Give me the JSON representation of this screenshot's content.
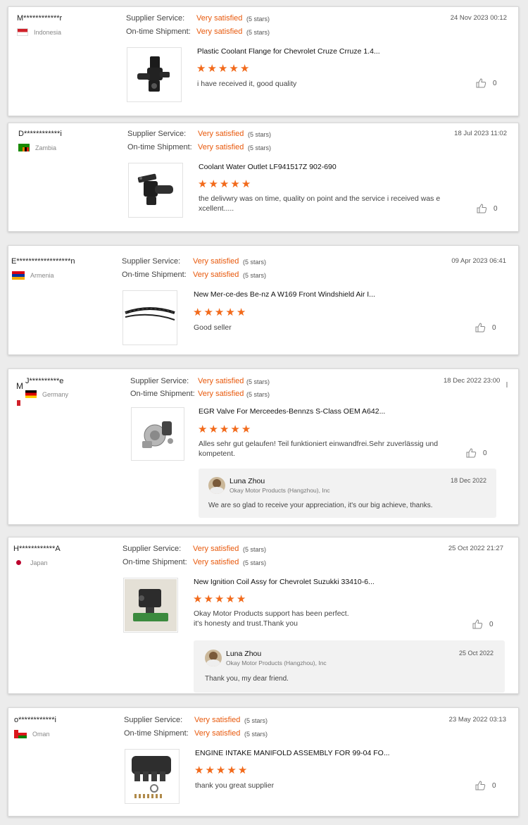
{
  "reviews": [
    {
      "user": "M************r",
      "country": "Indonesia",
      "service_label": "Supplier Service:",
      "service_value": "Very satisfied",
      "service_stars": "(5 stars)",
      "shipment_label": "On-time Shipment:",
      "shipment_value": "Very satisfied",
      "shipment_stars": "(5 stars)",
      "date": "24 Nov 2023 00:12",
      "product": "Plastic Coolant Flange for Chevrolet Cruze Crruze 1.4...",
      "rating": 5,
      "comment": "i have received it, good quality",
      "likes": "0"
    },
    {
      "user": "D************i",
      "country": "Zambia",
      "service_label": "Supplier Service:",
      "service_value": "Very satisfied",
      "service_stars": "(5 stars)",
      "shipment_label": "On-time Shipment:",
      "shipment_value": "Very satisfied",
      "shipment_stars": "(5 stars)",
      "date": "18 Jul 2023 11:02",
      "product": "Coolant Water Outlet LF941517Z 902-690",
      "rating": 5,
      "comment_line1": "the delivwry was on time, quality on point and the service i received was e",
      "comment_line2": "xcellent.....",
      "likes": "0"
    },
    {
      "user": "E******************n",
      "country": "Armenia",
      "service_label": "Supplier Service:",
      "service_value": "Very satisfied",
      "service_stars": "(5 stars)",
      "shipment_label": "On-time Shipment:",
      "shipment_value": "Very satisfied",
      "shipment_stars": "(5 stars)",
      "date": "09 Apr 2023 06:41",
      "product": "New Mer-ce-des Be-nz A W169 Front Windshield Air I...",
      "rating": 5,
      "comment": "Good seller",
      "likes": "0"
    },
    {
      "user_prefix": "M",
      "user": "J**********e",
      "country": "Germany",
      "service_label": "Supplier Service:",
      "service_value": "Very satisfied",
      "service_stars": "(5 stars)",
      "shipment_label": "On-time Shipment:",
      "shipment_value": "Very satisfied",
      "shipment_stars": "(5 stars)",
      "date": "18 Dec 2022 23:00",
      "product": "EGR Valve For Merceedes-Bennzs S-Class OEM A642...",
      "rating": 5,
      "comment_line1": "Alles sehr gut gelaufen! Teil funktioniert einwandfrei.Sehr zuverlässig und",
      "comment_line2": "kompetent.",
      "likes": "0",
      "reply": {
        "name": "Luna Zhou",
        "company": "Okay Motor Products (Hangzhou), Inc",
        "date": "18 Dec 2022",
        "text": "We are so glad to receive your appreciation, it's our big achieve, thanks."
      }
    },
    {
      "user": "H************A",
      "country": "Japan",
      "service_label": "Supplier Service:",
      "service_value": "Very satisfied",
      "service_stars": "(5 stars)",
      "shipment_label": "On-time Shipment:",
      "shipment_value": "Very satisfied",
      "shipment_stars": "(5 stars)",
      "date": "25 Oct 2022 21:27",
      "product": "New Ignition Coil Assy for Chevrolet Suzukki 33410-6...",
      "rating": 5,
      "comment_line1": "Okay Motor Products support has been perfect.",
      "comment_line2": "it's honesty and trust.Thank you",
      "likes": "0",
      "reply": {
        "name": "Luna Zhou",
        "company": "Okay Motor Products (Hangzhou), Inc",
        "date": "25 Oct 2022",
        "text": "Thank you, my dear friend."
      }
    },
    {
      "user": "o************i",
      "country": "Oman",
      "service_label": "Supplier Service:",
      "service_value": "Very satisfied",
      "service_stars": "(5 stars)",
      "shipment_label": "On-time Shipment:",
      "shipment_value": "Very satisfied",
      "shipment_stars": "(5 stars)",
      "date": "23 May 2022 03:13",
      "product": "ENGINE INTAKE MANIFOLD ASSEMBLY FOR 99-04 FO...",
      "rating": 5,
      "comment": "thank you great supplier",
      "likes": "0"
    }
  ],
  "colors": {
    "accent": "#e8590c",
    "star": "#f26a1b"
  }
}
